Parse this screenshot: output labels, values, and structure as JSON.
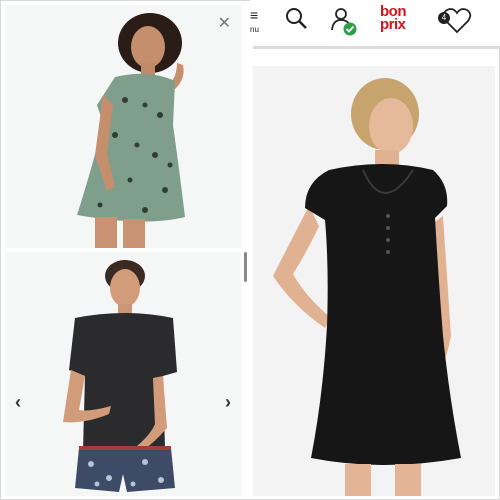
{
  "header": {
    "menu_label_partial": "≡",
    "menu_sub_partial": "nu",
    "logo_line1": "bon",
    "logo_line2": "prix",
    "wishlist_count": "4"
  },
  "gallery": {
    "close_symbol": "✕",
    "prev_symbol": "‹",
    "next_symbol": "›"
  },
  "colors": {
    "brand_red": "#d5131d",
    "check_green": "#2e9e4a",
    "leopard_green": "#7f9e8b",
    "dark_garment": "#2b2b2e",
    "black_dress": "#161616"
  }
}
